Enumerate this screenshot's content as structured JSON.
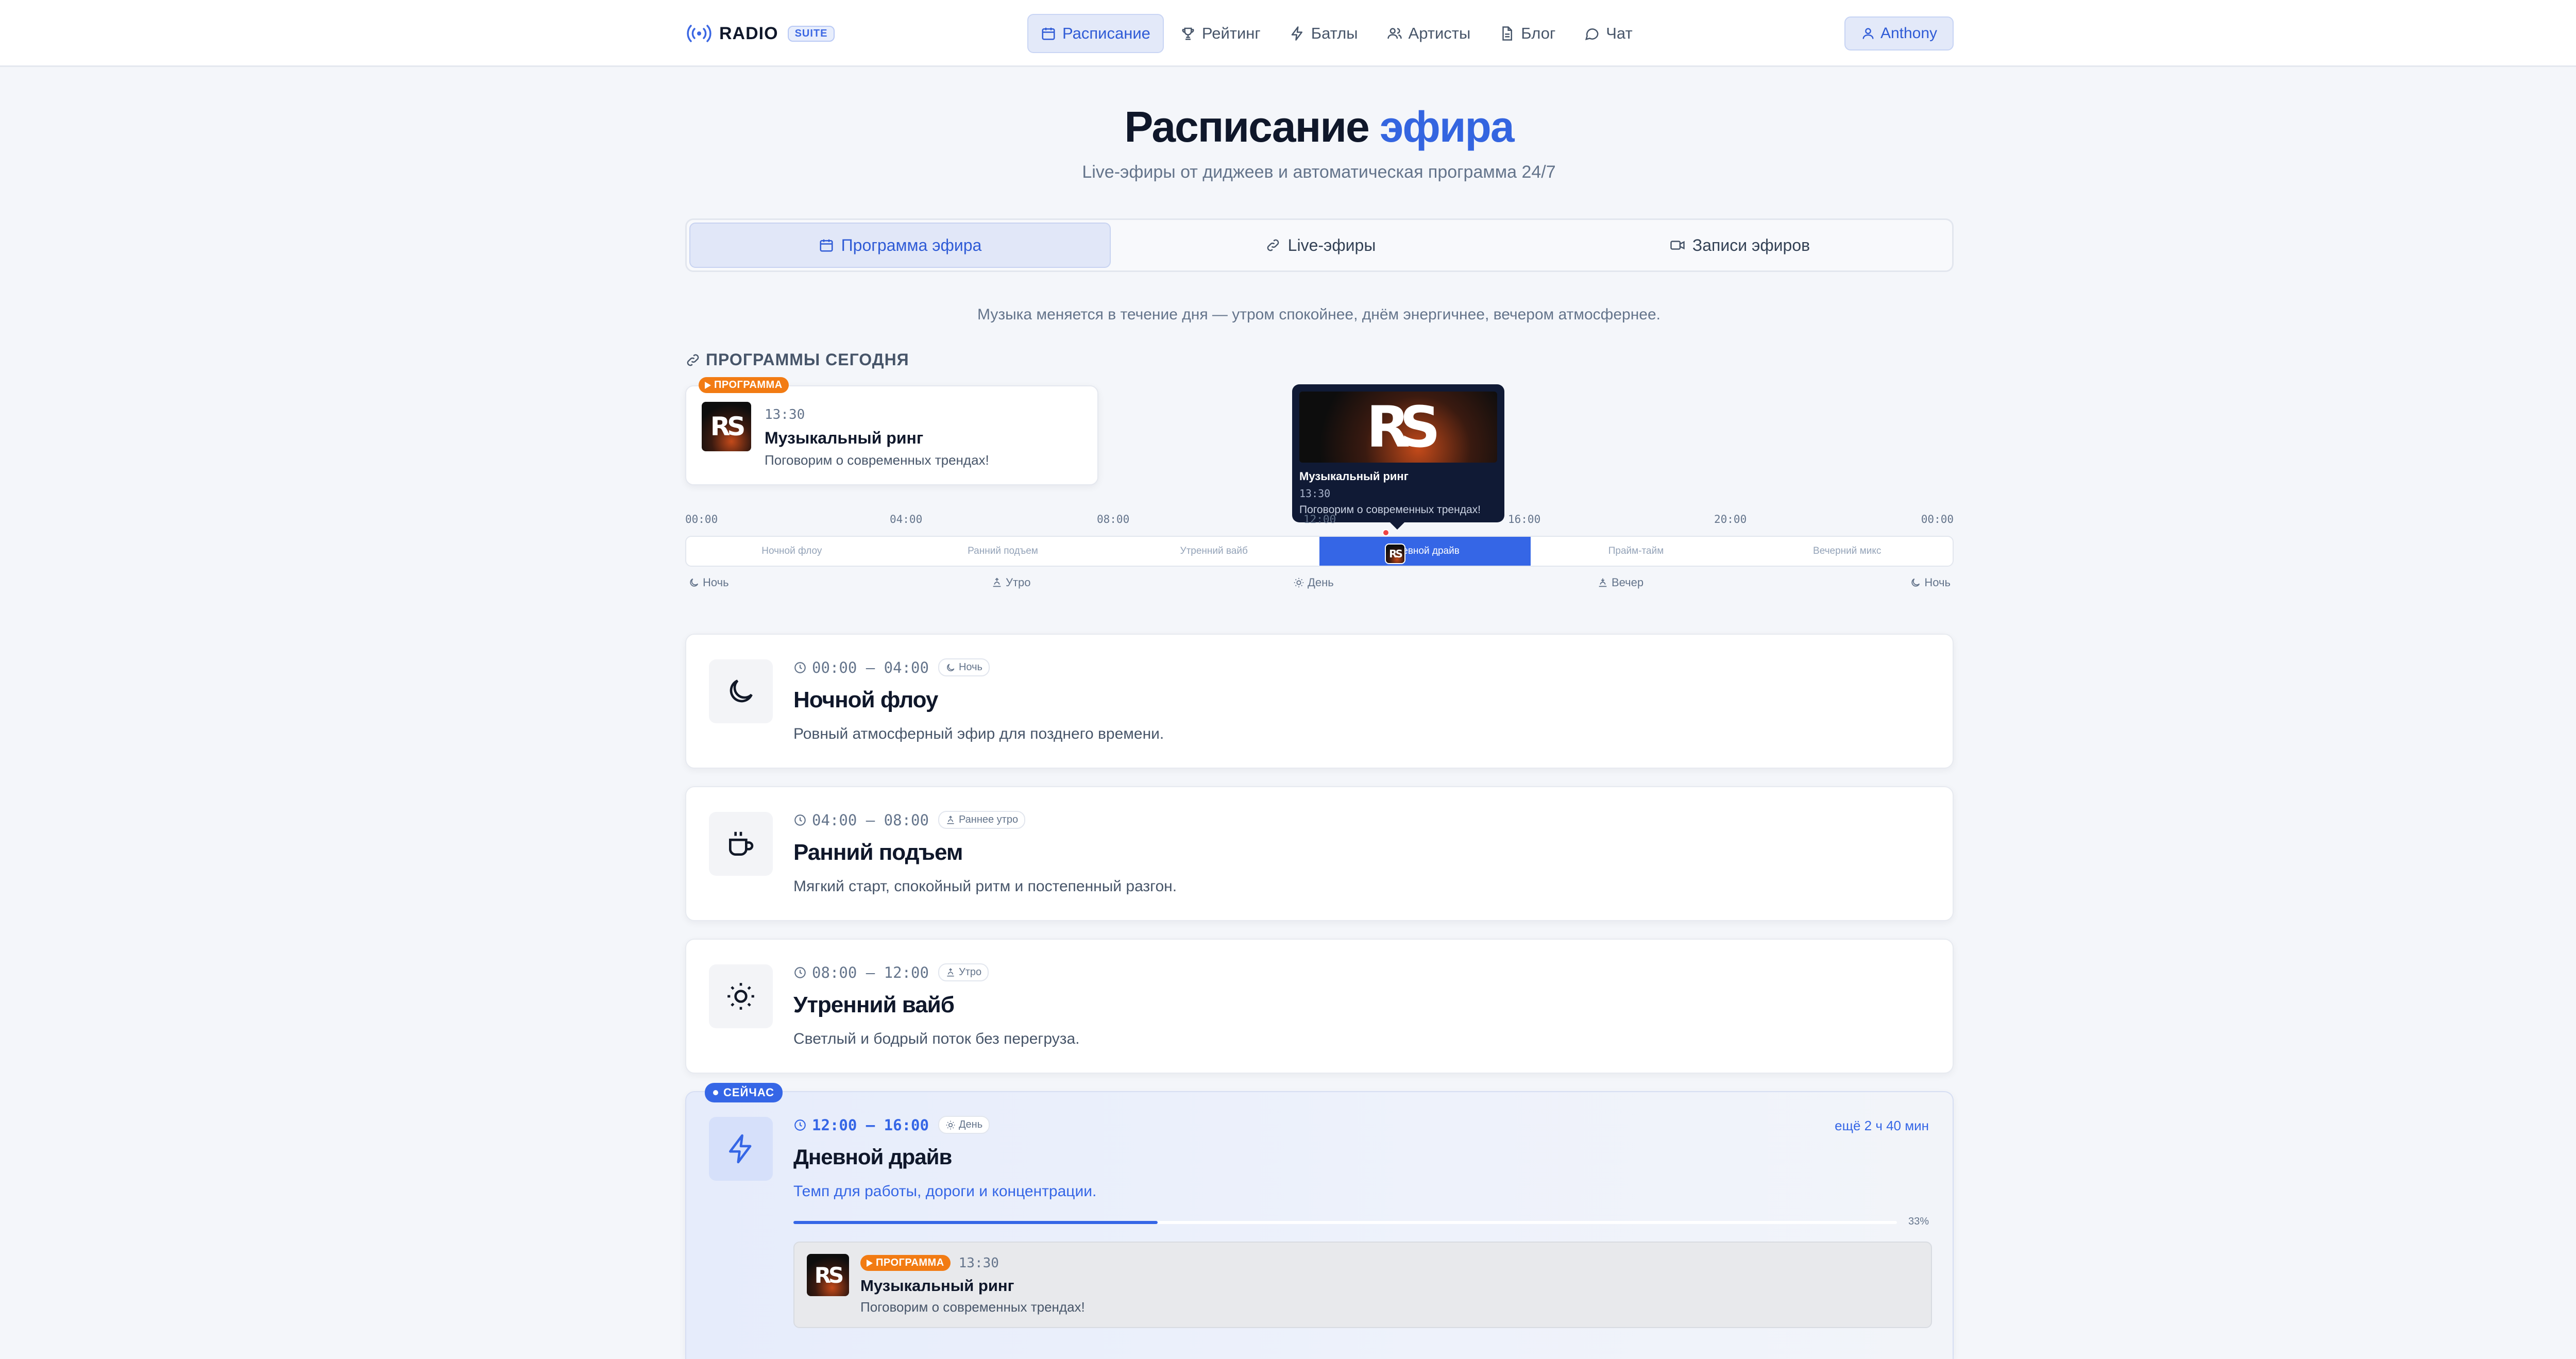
{
  "header": {
    "brand": "RADIO",
    "brand_badge": "SUITE",
    "nav": [
      {
        "label": "Расписание",
        "icon": "calendar-icon",
        "active": true
      },
      {
        "label": "Рейтинг",
        "icon": "trophy-icon",
        "active": false
      },
      {
        "label": "Батлы",
        "icon": "lightning-icon",
        "active": false
      },
      {
        "label": "Артисты",
        "icon": "users-icon",
        "active": false
      },
      {
        "label": "Блог",
        "icon": "document-icon",
        "active": false
      },
      {
        "label": "Чат",
        "icon": "chat-icon",
        "active": false
      }
    ],
    "user": "Anthony"
  },
  "page": {
    "title_main": "Расписание",
    "title_accent": "эфира",
    "subtitle": "Live-эфиры от диджеев и автоматическая программа 24/7"
  },
  "tabs": [
    {
      "label": "Программа эфира",
      "icon": "calendar-icon",
      "active": true
    },
    {
      "label": "Live-эфиры",
      "icon": "link-icon",
      "active": false
    },
    {
      "label": "Записи эфиров",
      "icon": "video-icon",
      "active": false
    }
  ],
  "intro": "Музыка меняется в течение дня — утром спокойнее, днём энергичнее, вечером атмосфернее.",
  "programs_today": {
    "label": "ПРОГРАММЫ СЕГОДНЯ",
    "card": {
      "badge": "ПРОГРАММА",
      "cover_text": "RS",
      "time": "13:30",
      "name": "Музыкальный ринг",
      "desc": "Поговорим о современных трендах!"
    },
    "tooltip": {
      "cover_text": "RS",
      "name": "Музыкальный ринг",
      "time": "13:30",
      "desc": "Поговорим о современных трендах!"
    }
  },
  "timeline": {
    "hours": [
      "00:00",
      "04:00",
      "08:00",
      "12:00",
      "16:00",
      "20:00",
      "00:00"
    ],
    "segments": [
      "Ночной флоу",
      "Ранний подъем",
      "Утренний вайб",
      "Дневной драйв",
      "Прайм-тайм",
      "Вечерний микс"
    ],
    "active_index": 3,
    "periods": [
      {
        "label": "Ночь",
        "icon": "moon-icon"
      },
      {
        "label": "Утро",
        "icon": "sunrise-icon"
      },
      {
        "label": "День",
        "icon": "sun-icon"
      },
      {
        "label": "Вечер",
        "icon": "sunset-icon"
      },
      {
        "label": "Ночь",
        "icon": "moon-icon"
      }
    ],
    "thumb_text": "RS"
  },
  "slots": [
    {
      "range": "00:00 — 04:00",
      "chip": "Ночь",
      "chip_icon": "moon-icon",
      "name": "Ночной флоу",
      "desc": "Ровный атмосферный эфир для позднего времени.",
      "icon": "moon-icon"
    },
    {
      "range": "04:00 — 08:00",
      "chip": "Раннее утро",
      "chip_icon": "sunrise-icon",
      "name": "Ранний подъем",
      "desc": "Мягкий старт, спокойный ритм и постепенный разгон.",
      "icon": "coffee-icon"
    },
    {
      "range": "08:00 — 12:00",
      "chip": "Утро",
      "chip_icon": "sunrise-icon",
      "name": "Утренний вайб",
      "desc": "Светлый и бодрый поток без перегруза.",
      "icon": "sun-icon"
    }
  ],
  "current_slot": {
    "badge": "СЕЙЧАС",
    "range": "12:00 — 16:00",
    "chip": "День",
    "chip_icon": "sun-icon",
    "name": "Дневной драйв",
    "desc": "Темп для работы, дороги и концентрации.",
    "remaining": "ещё 2 ч 40 мин",
    "progress": 0.33,
    "progress_label": "33%",
    "icon": "lightning-icon",
    "program": {
      "badge": "ПРОГРАММА",
      "cover_text": "RS",
      "time": "13:30",
      "name": "Музыкальный ринг",
      "desc": "Поговорим о современных трендах!"
    }
  },
  "colors": {
    "accent": "#3566e6",
    "program_badge": "#f27b13",
    "tooltip_bg": "#101a35"
  }
}
